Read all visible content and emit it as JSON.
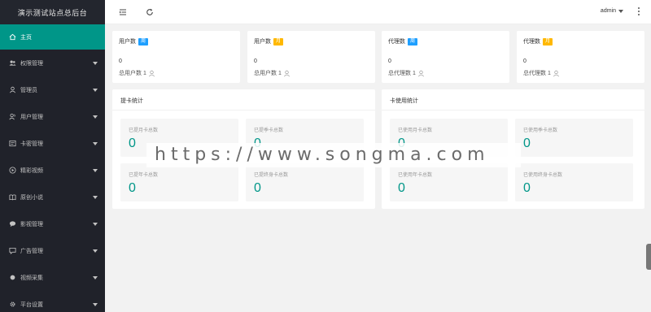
{
  "sidebar": {
    "logo": "演示测试站点总后台",
    "items": [
      {
        "label": "主页",
        "icon": "home-icon",
        "active": true,
        "arrow": false
      },
      {
        "label": "权限管理",
        "icon": "users-icon",
        "active": false,
        "arrow": true
      },
      {
        "label": "管理员",
        "icon": "user-icon",
        "active": false,
        "arrow": true
      },
      {
        "label": "用户管理",
        "icon": "user-group-icon",
        "active": false,
        "arrow": true
      },
      {
        "label": "卡密管理",
        "icon": "card-icon",
        "active": false,
        "arrow": true
      },
      {
        "label": "精彩视频",
        "icon": "play-icon",
        "active": false,
        "arrow": true
      },
      {
        "label": "原创小说",
        "icon": "book-icon",
        "active": false,
        "arrow": true
      },
      {
        "label": "影视管理",
        "icon": "chat-icon",
        "active": false,
        "arrow": true
      },
      {
        "label": "广告管理",
        "icon": "ad-icon",
        "active": false,
        "arrow": true
      },
      {
        "label": "视频采集",
        "icon": "dot-icon",
        "active": false,
        "arrow": true
      },
      {
        "label": "平台设置",
        "icon": "gear-icon",
        "active": false,
        "arrow": true
      }
    ]
  },
  "header": {
    "user": "admin"
  },
  "stats": [
    {
      "title": "用户数",
      "badge": "周",
      "badge_color": "#1e9fff",
      "value": "0",
      "total_label": "总用户数 1"
    },
    {
      "title": "用户数",
      "badge": "月",
      "badge_color": "#ffb800",
      "value": "0",
      "total_label": "总用户数 1"
    },
    {
      "title": "代理数",
      "badge": "周",
      "badge_color": "#1e9fff",
      "value": "0",
      "total_label": "总代理数 1"
    },
    {
      "title": "代理数",
      "badge": "月",
      "badge_color": "#ffb800",
      "value": "0",
      "total_label": "总代理数 1"
    }
  ],
  "panels": [
    {
      "title": "提卡统计",
      "tiles": [
        {
          "label": "已提月卡总数",
          "value": "0"
        },
        {
          "label": "已提季卡总数",
          "value": "0"
        },
        {
          "label": "已提年卡总数",
          "value": "0"
        },
        {
          "label": "已提终身卡总数",
          "value": "0"
        }
      ]
    },
    {
      "title": "卡使用统计",
      "tiles": [
        {
          "label": "已使用月卡总数",
          "value": "0"
        },
        {
          "label": "已使用季卡总数",
          "value": "0"
        },
        {
          "label": "已使用年卡总数",
          "value": "0"
        },
        {
          "label": "已使用终身卡总数",
          "value": "0"
        }
      ]
    }
  ],
  "watermark": "https://www.songma.com",
  "colors": {
    "accent": "#009688",
    "sidebar": "#20222a",
    "week_badge": "#1e9fff",
    "month_badge": "#ffb800"
  }
}
